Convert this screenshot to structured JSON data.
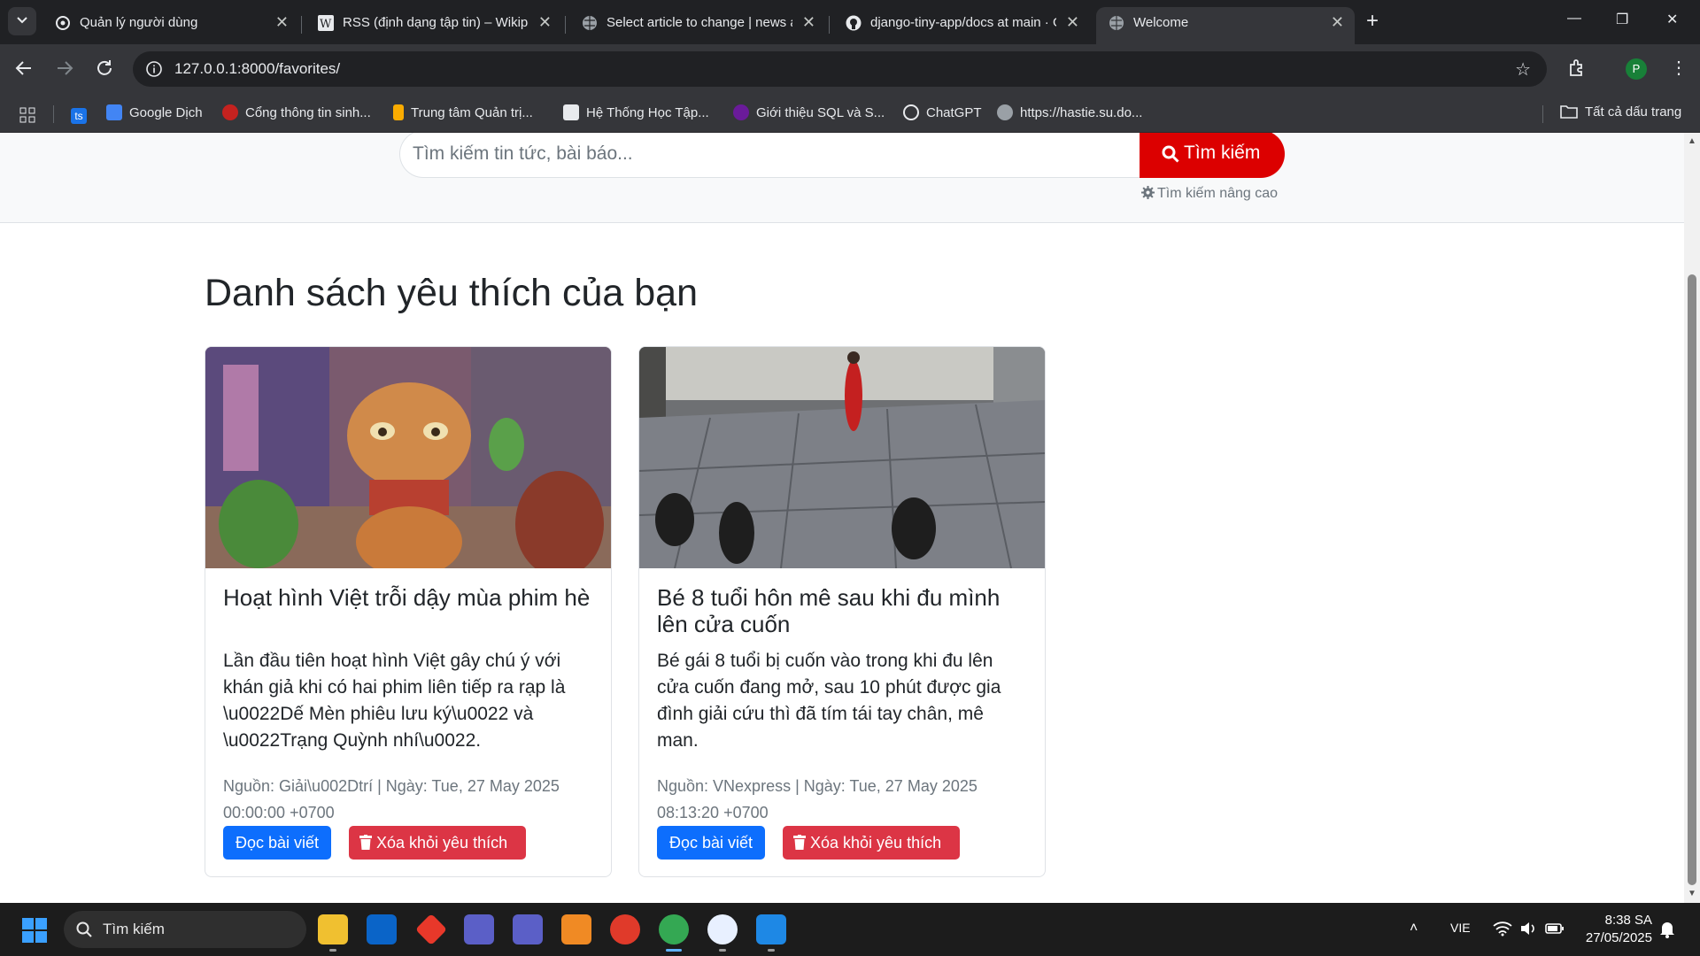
{
  "browser": {
    "tabs": [
      {
        "title": "Quản lý người dùng",
        "icon": "openai-icon"
      },
      {
        "title": "RSS (định dạng tập tin) – Wikipedia",
        "icon": "wikipedia-icon"
      },
      {
        "title": "Select article to change | news admin",
        "icon": "globe-icon"
      },
      {
        "title": "django-tiny-app/docs at main · GitHub",
        "icon": "github-icon"
      },
      {
        "title": "Welcome",
        "icon": "globe-icon"
      }
    ],
    "url": "127.0.0.1:8000/favorites/",
    "profile_initial": "P",
    "bookmarks": [
      {
        "label": "",
        "icon": "ts-icon"
      },
      {
        "label": "Google Dịch",
        "icon": "google-translate-icon"
      },
      {
        "label": "Cổng thông tin sinh...",
        "icon": "portal-icon"
      },
      {
        "label": "Trung tâm Quản trị...",
        "icon": "admin-icon"
      },
      {
        "label": "Hệ Thống Học Tập...",
        "icon": "lms-icon"
      },
      {
        "label": "Giới thiệu SQL và S...",
        "icon": "sql-icon"
      },
      {
        "label": "ChatGPT",
        "icon": "openai-icon"
      },
      {
        "label": "https://hastie.su.do...",
        "icon": "globe-icon"
      }
    ],
    "all_bookmarks": "Tất cả dấu trang"
  },
  "search": {
    "placeholder": "Tìm kiếm tin tức, bài báo...",
    "button": "Tìm kiếm",
    "advanced": "Tìm kiếm nâng cao"
  },
  "page": {
    "heading": "Danh sách yêu thích của bạn"
  },
  "favorites": [
    {
      "title": "Hoạt hình Việt trỗi dậy mùa phim hè",
      "summary": "Lần đầu tiên hoạt hình Việt gây chú ý với khán giả khi có hai phim liên tiếp ra rạp là \\u0022Dế Mèn phiêu lưu ký\\u0022 và \\u0022Trạng Quỳnh nhí\\u0022.",
      "meta": "Nguồn: Giải\\u002Dtrí | Ngày: Tue, 27 May 2025 00:00:00 +0700",
      "read_label": "Đọc bài viết",
      "remove_label": "Xóa khỏi yêu thích"
    },
    {
      "title": "Bé 8 tuổi hôn mê sau khi đu mình lên cửa cuốn",
      "summary": "Bé gái 8 tuổi bị cuốn vào trong khi đu lên cửa cuốn đang mở, sau 10 phút được gia đình giải cứu thì đã tím tái tay chân, mê man.",
      "meta": "Nguồn: VNexpress | Ngày: Tue, 27 May 2025 08:13:20 +0700",
      "read_label": "Đọc bài viết",
      "remove_label": "Xóa khỏi yêu thích"
    }
  ],
  "taskbar": {
    "search_label": "Tìm kiếm",
    "language": "VIE",
    "time": "8:38 SA",
    "date": "27/05/2025"
  },
  "colors": {
    "brand_red": "#dc0000",
    "primary_blue": "#0d6efd",
    "danger_red": "#dc3545"
  }
}
